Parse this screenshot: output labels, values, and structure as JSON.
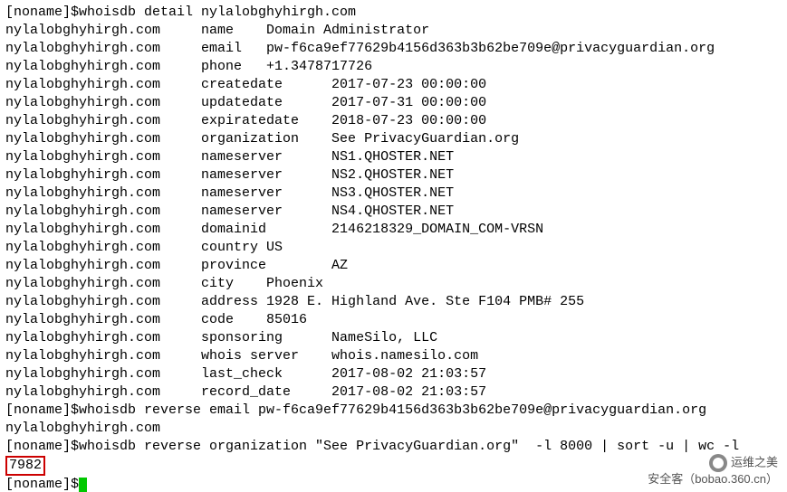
{
  "prompt1_user": "[noname]$",
  "cmd1": "whoisdb detail nylalobghyhirgh.com",
  "domain": "nylalobghyhirgh.com",
  "rows": [
    {
      "field": "name",
      "pad": 8,
      "value": "Domain Administrator"
    },
    {
      "field": "email",
      "pad": 8,
      "value": "pw-f6ca9ef77629b4156d363b3b62be709e@privacyguardian.org"
    },
    {
      "field": "phone",
      "pad": 8,
      "value": "+1.3478717726"
    },
    {
      "field": "createdate",
      "pad": 16,
      "value": "2017-07-23 00:00:00"
    },
    {
      "field": "updatedate",
      "pad": 16,
      "value": "2017-07-31 00:00:00"
    },
    {
      "field": "expiratedate",
      "pad": 16,
      "value": "2018-07-23 00:00:00"
    },
    {
      "field": "organization",
      "pad": 16,
      "value": "See PrivacyGuardian.org"
    },
    {
      "field": "nameserver",
      "pad": 16,
      "value": "NS1.QHOSTER.NET"
    },
    {
      "field": "nameserver",
      "pad": 16,
      "value": "NS2.QHOSTER.NET"
    },
    {
      "field": "nameserver",
      "pad": 16,
      "value": "NS3.QHOSTER.NET"
    },
    {
      "field": "nameserver",
      "pad": 16,
      "value": "NS4.QHOSTER.NET"
    },
    {
      "field": "domainid",
      "pad": 16,
      "value": "2146218329_DOMAIN_COM-VRSN"
    },
    {
      "field": "country",
      "pad": 0,
      "value": "US"
    },
    {
      "field": "province",
      "pad": 16,
      "value": "AZ"
    },
    {
      "field": "city",
      "pad": 8,
      "value": "Phoenix"
    },
    {
      "field": "address",
      "pad": 0,
      "value": "1928 E. Highland Ave. Ste F104 PMB# 255"
    },
    {
      "field": "code",
      "pad": 8,
      "value": "85016"
    },
    {
      "field": "sponsoring",
      "pad": 16,
      "value": "NameSilo, LLC"
    },
    {
      "field": "whois server",
      "pad": 16,
      "value": "whois.namesilo.com"
    },
    {
      "field": "last_check",
      "pad": 16,
      "value": "2017-08-02 21:03:57"
    },
    {
      "field": "record_date",
      "pad": 16,
      "value": "2017-08-02 21:03:57"
    }
  ],
  "cmd2": "whoisdb reverse email pw-f6ca9ef77629b4156d363b3b62be709e@privacyguardian.org",
  "result2": "nylalobghyhirgh.com",
  "cmd3": "whoisdb reverse organization \"See PrivacyGuardian.org\"  -l 8000 | sort -u | wc -l",
  "result3": "7982",
  "watermark_line1": "运维之美",
  "watermark_line2": "安全客（bobao.360.cn）"
}
